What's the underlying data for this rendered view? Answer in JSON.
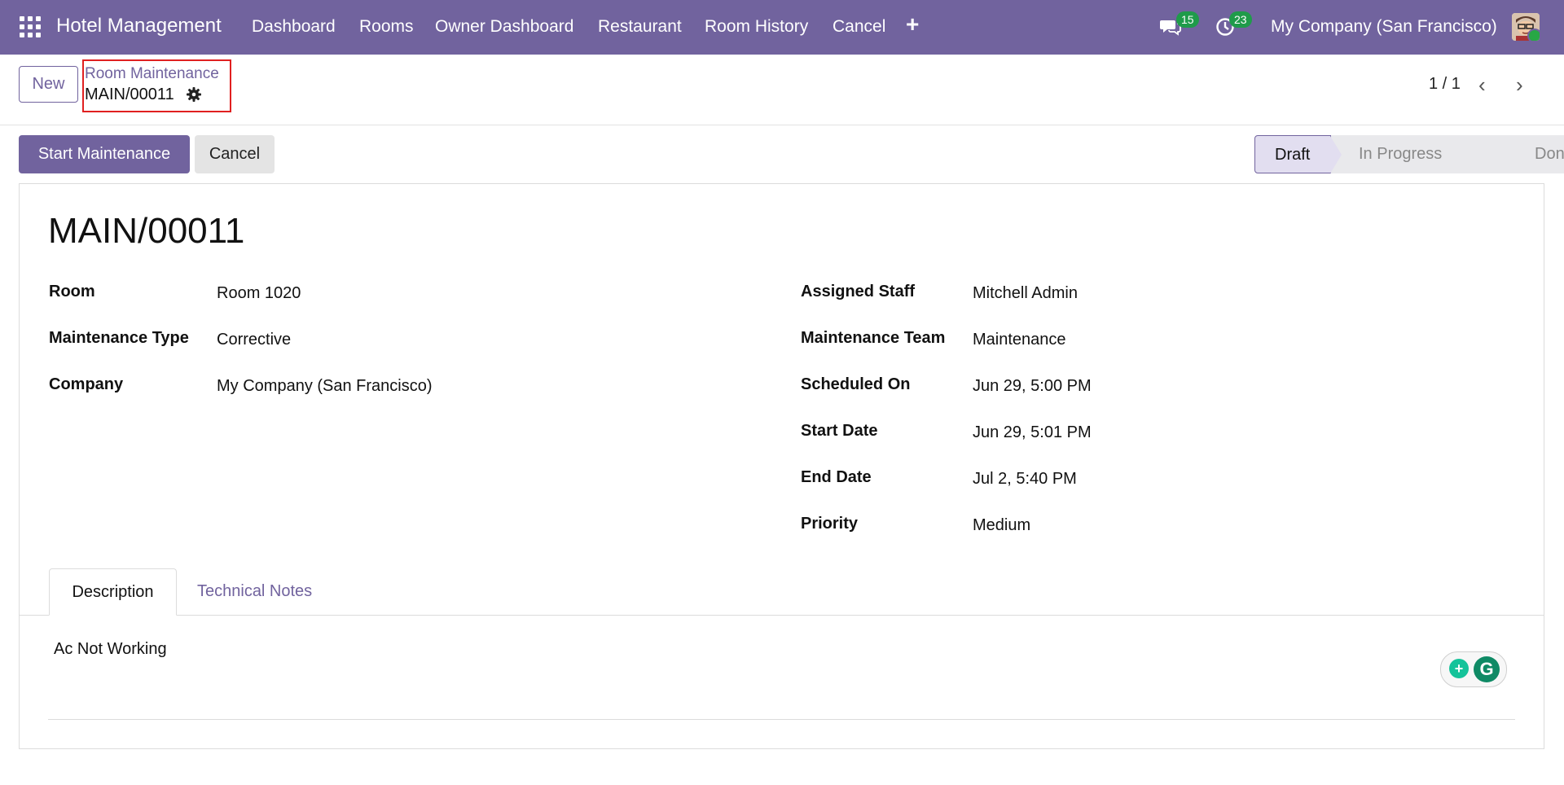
{
  "nav": {
    "brand": "Hotel Management",
    "items": [
      "Dashboard",
      "Rooms",
      "Owner Dashboard",
      "Restaurant",
      "Room History",
      "Cancel"
    ],
    "messages_count": "15",
    "activities_count": "23",
    "company": "My Company (San Francisco)"
  },
  "control": {
    "new_label": "New",
    "breadcrumb_parent": "Room Maintenance",
    "breadcrumb_current": "MAIN/00011",
    "pager": "1 / 1"
  },
  "actions": {
    "start_label": "Start Maintenance",
    "cancel_label": "Cancel"
  },
  "status": {
    "stages": [
      "Draft",
      "In Progress",
      "Done"
    ],
    "active": "Draft"
  },
  "record": {
    "title": "MAIN/00011",
    "left_fields": [
      {
        "label": "Room",
        "value": "Room 1020"
      },
      {
        "label": "Maintenance Type",
        "value": "Corrective"
      },
      {
        "label": "Company",
        "value": "My Company (San Francisco)"
      }
    ],
    "right_fields": [
      {
        "label": "Assigned Staff",
        "value": "Mitchell Admin"
      },
      {
        "label": "Maintenance Team",
        "value": "Maintenance"
      },
      {
        "label": "Scheduled On",
        "value": "Jun 29, 5:00 PM"
      },
      {
        "label": "Start Date",
        "value": "Jun 29, 5:01 PM"
      },
      {
        "label": "End Date",
        "value": "Jul 2, 5:40 PM"
      },
      {
        "label": "Priority",
        "value": "Medium"
      }
    ]
  },
  "tabs": [
    "Description",
    "Technical Notes"
  ],
  "description": "Ac Not Working",
  "colors": {
    "brand": "#71639e",
    "badge": "#1f9b4a",
    "highlight_border": "#e02020"
  }
}
